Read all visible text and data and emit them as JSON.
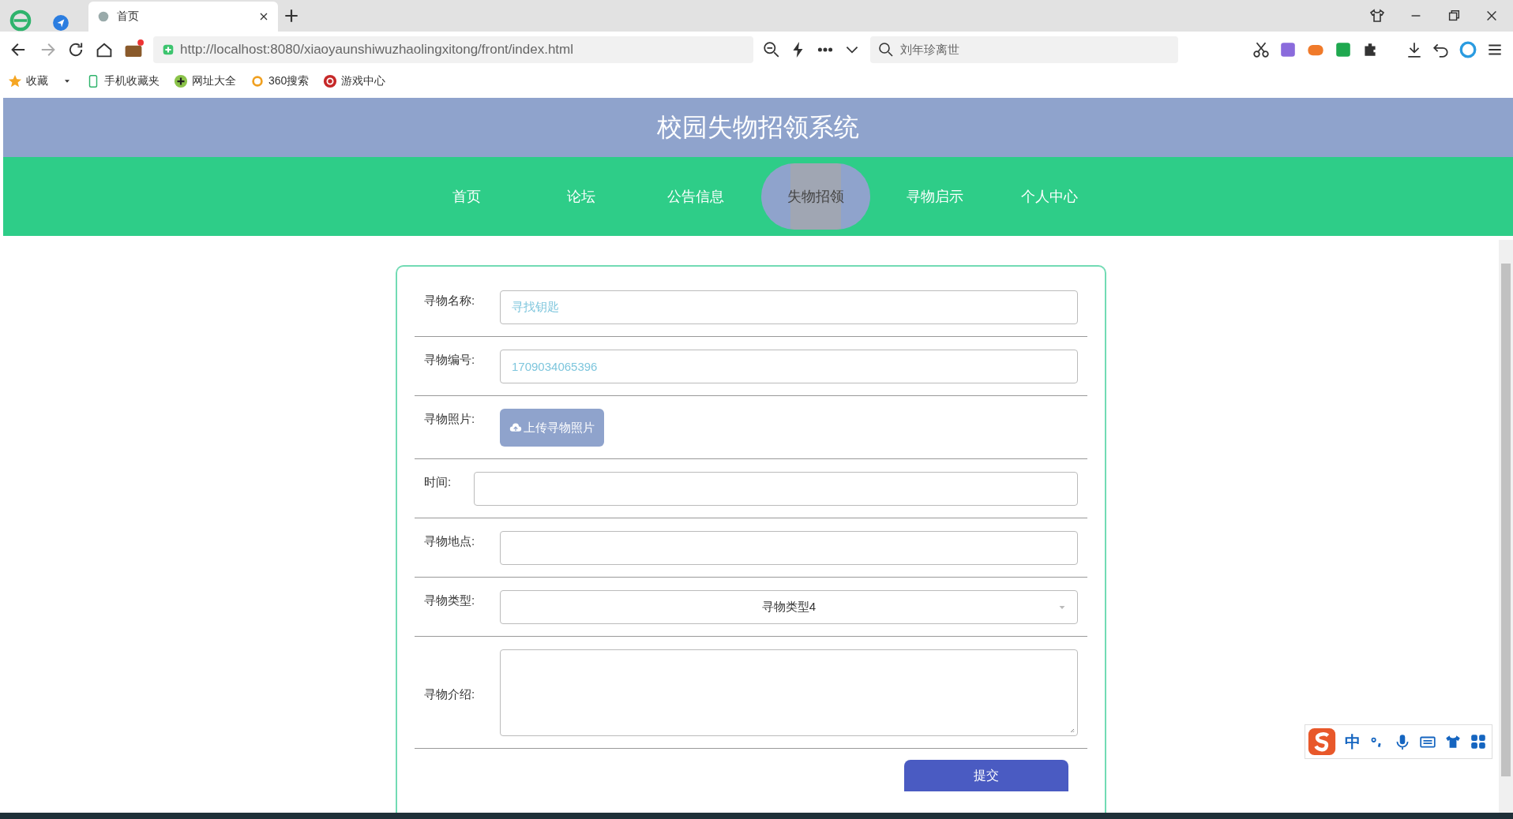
{
  "browser": {
    "tabs": [
      {
        "title": "首页",
        "selected": true
      }
    ],
    "url": "http://localhost:8080/xiaoyaunshiwuzhaolingxitong/front/index.html",
    "search_placeholder": "刘年珍离世",
    "bookmarks": [
      "收藏",
      "手机收藏夹",
      "网址大全",
      "360搜索",
      "游戏中心"
    ]
  },
  "site": {
    "title": "校园失物招领系统",
    "nav": [
      {
        "label": "首页",
        "selected": false
      },
      {
        "label": "论坛",
        "selected": false
      },
      {
        "label": "公告信息",
        "selected": false
      },
      {
        "label": "失物招领",
        "selected": true
      },
      {
        "label": "寻物启示",
        "selected": false
      },
      {
        "label": "个人中心",
        "selected": false
      }
    ]
  },
  "form": {
    "fields": [
      {
        "kind": "text",
        "label": "寻物名称:",
        "value": "寻找钥匙"
      },
      {
        "kind": "text",
        "label": "寻物编号:",
        "value": "1709034065396"
      },
      {
        "kind": "upload",
        "label": "寻物照片:",
        "button": "上传寻物照片"
      },
      {
        "kind": "wide",
        "label": "时间:"
      },
      {
        "kind": "text",
        "label": "寻物地点:"
      },
      {
        "kind": "select",
        "label": "寻物类型:",
        "value": "寻物类型4"
      },
      {
        "kind": "textarea",
        "label": "寻物介绍:"
      }
    ],
    "submit": "提交"
  },
  "ime": {
    "label": "中"
  }
}
